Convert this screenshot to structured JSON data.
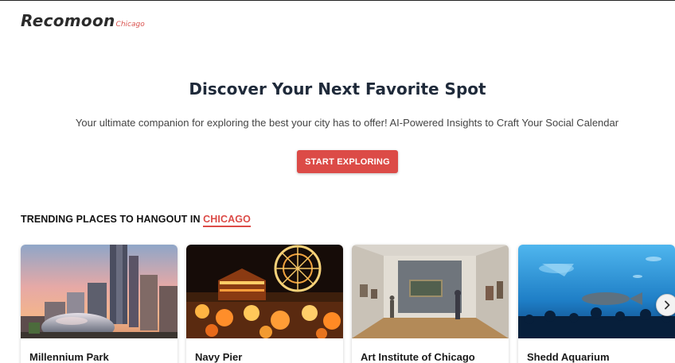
{
  "brand": {
    "name": "Recomoon",
    "city": "Chicago"
  },
  "hero": {
    "title": "Discover Your Next Favorite Spot",
    "subtitle": "Your ultimate companion for exploring the best your city has to offer! AI-Powered Insights to Craft Your Social Calendar",
    "cta_label": "START EXPLORING"
  },
  "trending": {
    "heading_prefix": "TRENDING PLACES TO HANGOUT IN",
    "city": "CHICAGO",
    "places": [
      {
        "name": "Millennium Park"
      },
      {
        "name": "Navy Pier"
      },
      {
        "name": "Art Institute of Chicago"
      },
      {
        "name": "Shedd Aquarium"
      }
    ]
  },
  "colors": {
    "accent": "#dc4b47",
    "heading": "#1f2a3a"
  },
  "icons": {
    "next": "chevron-right-icon"
  }
}
